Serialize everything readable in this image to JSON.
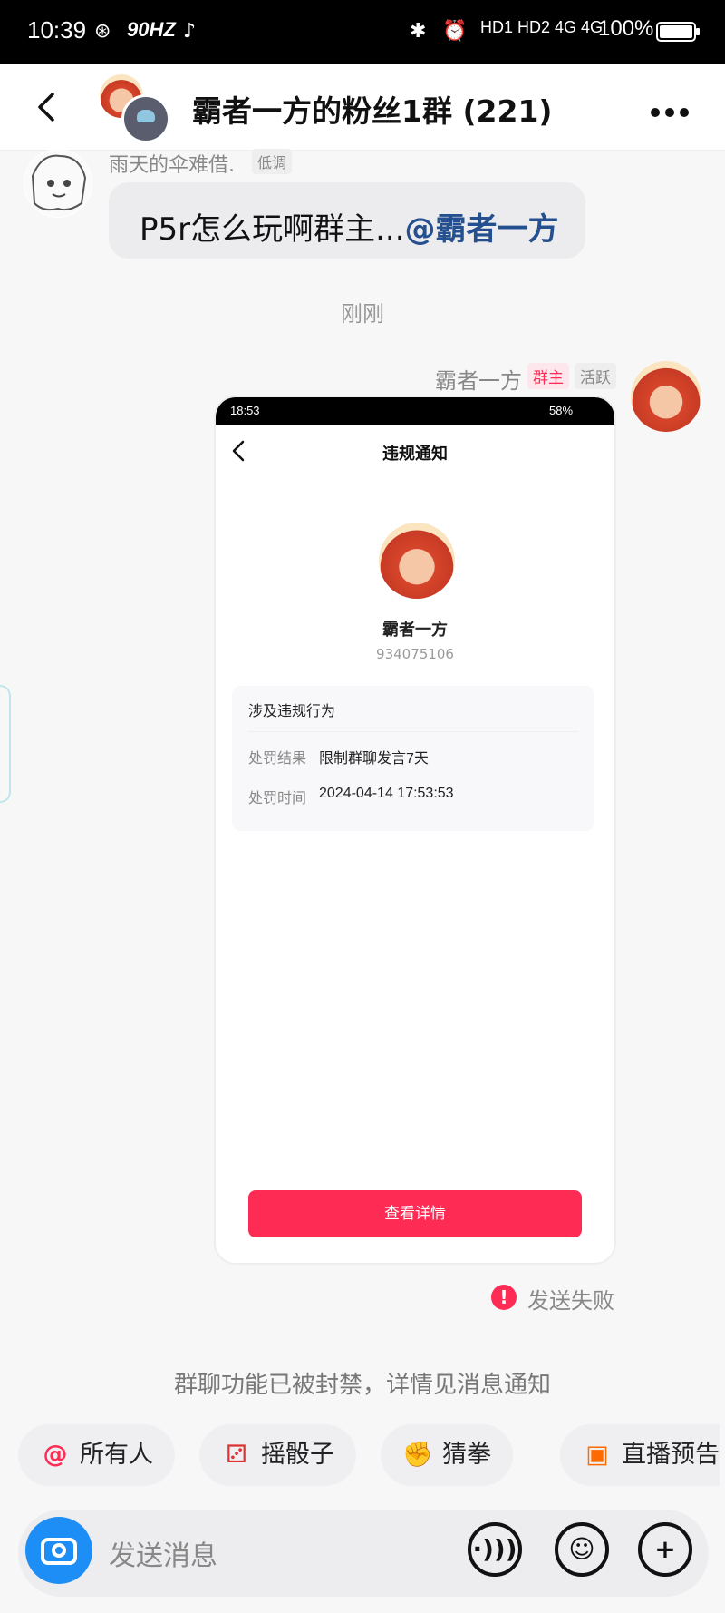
{
  "status_bar": {
    "time": "10:39",
    "refresh_rate": "90HZ",
    "network": "HD1 HD2 4G 4G",
    "battery": "100%"
  },
  "header": {
    "title": "霸者一方的粉丝1群 (221)"
  },
  "messages": {
    "incoming": {
      "sender": "雨天的伞难借.",
      "sender_tag": "低调",
      "text": "P5r怎么玩啊群主...",
      "mention": "@霸者一方"
    },
    "timestamp": "刚刚",
    "outgoing": {
      "sender": "霸者一方",
      "role": "群主",
      "activity": "活跃",
      "screenshot": {
        "status_time": "18:53",
        "status_battery": "58%",
        "title": "违规通知",
        "user_name": "霸者一方",
        "user_id": "934075106",
        "section_title": "涉及违规行为",
        "result_label": "处罚结果",
        "result_value": "限制群聊发言7天",
        "time_label": "处罚时间",
        "time_value": "2024-04-14 17:53:53",
        "button": "查看详情"
      },
      "fail_icon": "!",
      "fail_text": "发送失败"
    },
    "system_notice": "群聊功能已被封禁，详情见消息通知"
  },
  "quick_actions": [
    {
      "icon": "@",
      "label": "所有人"
    },
    {
      "icon": "⚂",
      "label": "摇骰子"
    },
    {
      "icon": "✊",
      "label": "猜拳"
    },
    {
      "icon": "▣",
      "label": "直播预告"
    }
  ],
  "input": {
    "placeholder": "发送消息"
  },
  "colors": {
    "accent": "#fe2c55",
    "mention": "#24508f",
    "camera": "#1d8ef6"
  }
}
